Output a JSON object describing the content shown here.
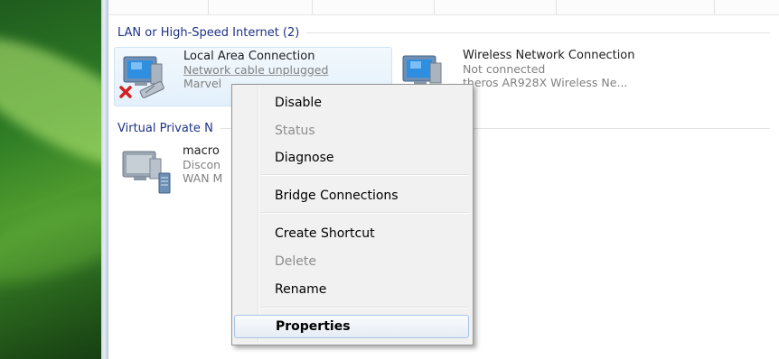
{
  "groups": {
    "lan": {
      "title": "LAN or High-Speed Internet (2)"
    },
    "vpn": {
      "title": "Virtual Private N"
    }
  },
  "connections": [
    {
      "name": "Local Area Connection",
      "status": "Network cable unplugged",
      "device": "Marvel"
    },
    {
      "name": "Wireless Network Connection",
      "status": "Not connected",
      "device": "theros AR928X Wireless Ne..."
    },
    {
      "name": "macro",
      "status": "Discon",
      "device": "WAN M"
    }
  ],
  "context_menu": {
    "items": [
      {
        "label": "Disable",
        "enabled": true
      },
      {
        "label": "Status",
        "enabled": false
      },
      {
        "label": "Diagnose",
        "enabled": true
      },
      {
        "label": "Bridge Connections",
        "enabled": true
      },
      {
        "label": "Create Shortcut",
        "enabled": true
      },
      {
        "label": "Delete",
        "enabled": false
      },
      {
        "label": "Rename",
        "enabled": true
      },
      {
        "label": "Properties",
        "enabled": true,
        "default": true,
        "highlighted": true
      }
    ]
  },
  "icons": {
    "lan": "network-adapter-icon",
    "unplugged": "red-x-icon",
    "wireless": "wireless-adapter-icon",
    "vpn": "vpn-server-icon"
  },
  "colors": {
    "group_header": "#1e3287",
    "secondary_text": "#808080",
    "menu_highlight_border": "#a8c4e6",
    "desktop_green": "#2f7d25"
  }
}
